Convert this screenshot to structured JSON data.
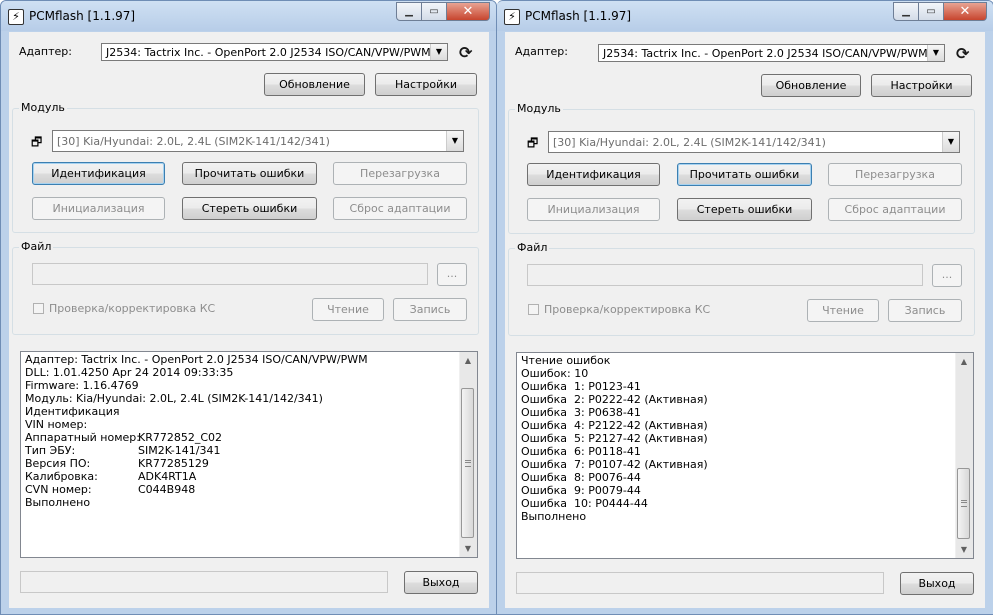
{
  "windows": [
    {
      "title": "PCMflash [1.1.97]",
      "adapter_label": "Адаптер:",
      "adapter_value": "J2534: Tactrix Inc. - OpenPort 2.0 J2534 ISO/CAN/VPW/PWM",
      "update_button": "Обновление",
      "settings_button": "Настройки",
      "module_group": "Модуль",
      "module_value": "[30] Kia/Hyundai: 2.0L, 2.4L (SIM2K-141/142/341)",
      "buttons": {
        "identify": "Идентификация",
        "read_errors": "Прочитать ошибки",
        "reboot": "Перезагрузка",
        "init": "Инициализация",
        "clear_errors": "Стереть ошибки",
        "reset_adapt": "Сброс адаптации"
      },
      "file_group": "Файл",
      "browse": "...",
      "checksum_label": "Проверка/корректировка КС",
      "read_button": "Чтение",
      "write_button": "Запись",
      "exit_button": "Выход",
      "log": [
        {
          "text": "Адаптер: Tactrix Inc. - OpenPort 2.0 J2534 ISO/CAN/VPW/PWM"
        },
        {
          "text": "DLL: 1.01.4250 Apr 24 2014 09:33:35"
        },
        {
          "text": "Firmware: 1.16.4769"
        },
        {
          "text": "Модуль: Kia/Hyundai: 2.0L, 2.4L (SIM2K-141/142/341)"
        },
        {
          "text": "Идентификация"
        },
        {
          "text": "VIN номер:"
        },
        {
          "key": "Аппаратный номер:",
          "value": "KR772852_C02"
        },
        {
          "key": "Тип ЭБУ:",
          "value": "SIM2K-141/341"
        },
        {
          "key": "Версия ПО:",
          "value": "KR77285129"
        },
        {
          "key": "Калибровка:",
          "value": "ADK4RT1A"
        },
        {
          "key": "CVN номер:",
          "value": "C044B948"
        },
        {
          "text": "Выполнено"
        }
      ],
      "scroll_position": 0.65
    },
    {
      "title": "PCMflash [1.1.97]",
      "adapter_label": "Адаптер:",
      "adapter_value": "J2534: Tactrix Inc. - OpenPort 2.0 J2534 ISO/CAN/VPW/PWM",
      "update_button": "Обновление",
      "settings_button": "Настройки",
      "module_group": "Модуль",
      "module_value": "[30] Kia/Hyundai: 2.0L, 2.4L (SIM2K-141/142/341)",
      "buttons": {
        "identify": "Идентификация",
        "read_errors": "Прочитать ошибки",
        "reboot": "Перезагрузка",
        "init": "Инициализация",
        "clear_errors": "Стереть ошибки",
        "reset_adapt": "Сброс адаптации"
      },
      "file_group": "Файл",
      "browse": "...",
      "checksum_label": "Проверка/корректировка КС",
      "read_button": "Чтение",
      "write_button": "Запись",
      "exit_button": "Выход",
      "log": [
        {
          "text": "Чтение ошибок"
        },
        {
          "text": "Ошибок: 10"
        },
        {
          "text": "Ошибка  1: P0123-41"
        },
        {
          "text": "Ошибка  2: P0222-42 (Активная)"
        },
        {
          "text": "Ошибка  3: P0638-41"
        },
        {
          "text": "Ошибка  4: P2122-42 (Активная)"
        },
        {
          "text": "Ошибка  5: P2127-42 (Активная)"
        },
        {
          "text": "Ошибка  6: P0118-41"
        },
        {
          "text": "Ошибка  7: P0107-42 (Активная)"
        },
        {
          "text": "Ошибка  8: P0076-44"
        },
        {
          "text": "Ошибка  9: P0079-44"
        },
        {
          "text": "Ошибка  10: P0444-44"
        },
        {
          "text": "Выполнено"
        }
      ],
      "scroll_position": 1.0
    }
  ]
}
